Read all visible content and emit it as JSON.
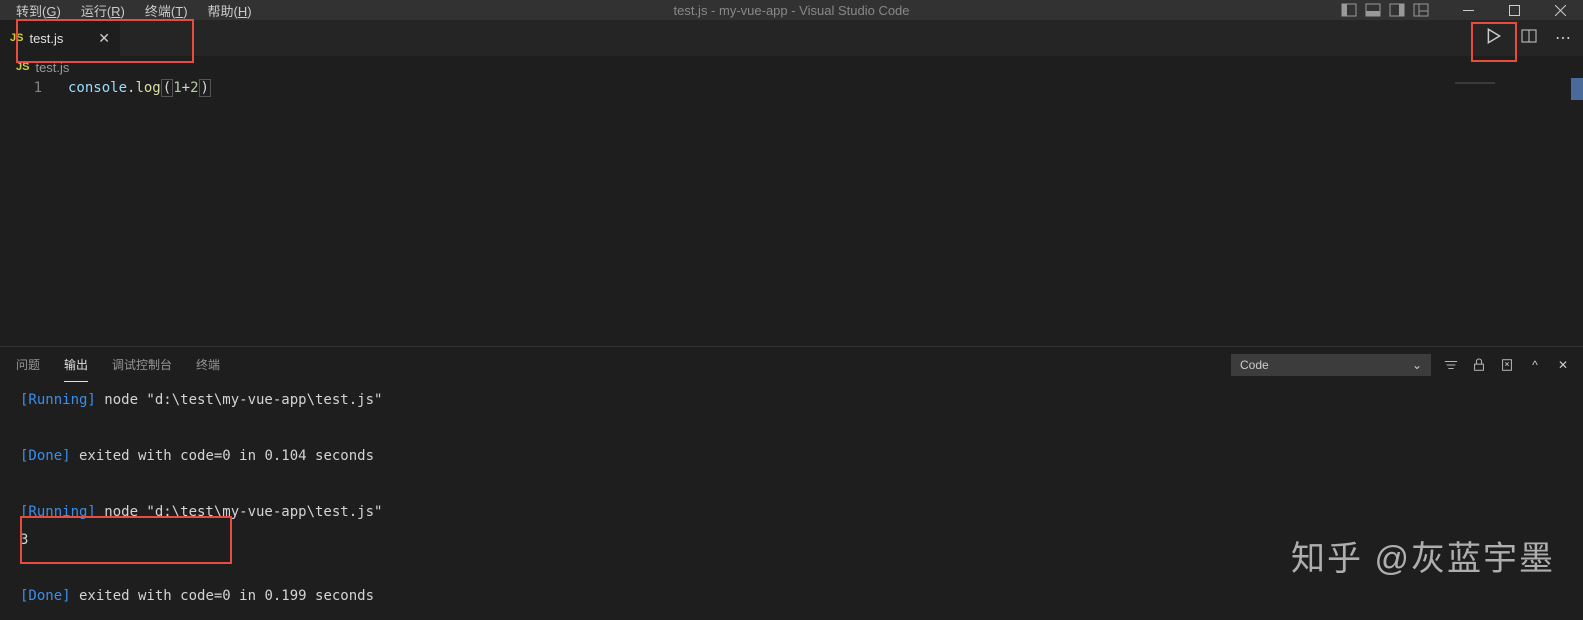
{
  "menubar": {
    "items": [
      {
        "label_pre": "转到(",
        "hotkey": "G",
        "label_post": ")"
      },
      {
        "label_pre": "运行(",
        "hotkey": "R",
        "label_post": ")"
      },
      {
        "label_pre": "终端(",
        "hotkey": "T",
        "label_post": ")"
      },
      {
        "label_pre": "帮助(",
        "hotkey": "H",
        "label_post": ")"
      }
    ],
    "title": "test.js - my-vue-app - Visual Studio Code"
  },
  "tab": {
    "badge": "JS",
    "label": "test.js"
  },
  "breadcrumb": {
    "badge": "JS",
    "file": "test.js"
  },
  "editor": {
    "line_number": "1",
    "tokens": {
      "console": "console",
      "dot": ".",
      "log": "log",
      "lparen": "(",
      "one": "1",
      "plus": "+",
      "two": "2",
      "rparen": ")"
    }
  },
  "panel": {
    "tabs": [
      {
        "label": "问题",
        "key": "problems"
      },
      {
        "label": "输出",
        "key": "output"
      },
      {
        "label": "调试控制台",
        "key": "debug-console"
      },
      {
        "label": "终端",
        "key": "terminal"
      }
    ],
    "active_tab": 1,
    "filter_value": "Code",
    "output": [
      {
        "tag": "[Running]",
        "rest": " node \"d:\\test\\my-vue-app\\test.js\""
      },
      {
        "tag": "",
        "rest": ""
      },
      {
        "tag": "[Done]",
        "rest": " exited with code=0 in 0.104 seconds"
      },
      {
        "tag": "",
        "rest": ""
      },
      {
        "tag": "[Running]",
        "rest": " node \"d:\\test\\my-vue-app\\test.js\""
      },
      {
        "tag": "",
        "rest": "3"
      },
      {
        "tag": "",
        "rest": ""
      },
      {
        "tag": "[Done]",
        "rest": " exited with code=0 in 0.199 seconds"
      }
    ]
  },
  "watermark": "知乎 @灰蓝宇墨"
}
